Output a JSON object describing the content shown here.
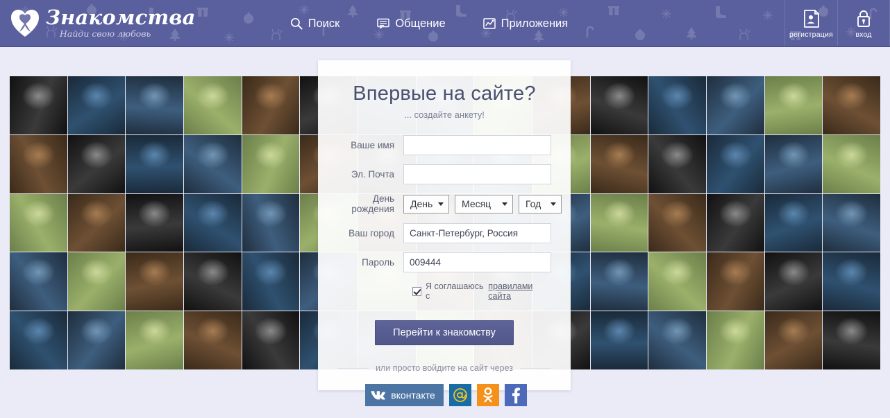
{
  "header": {
    "logo": {
      "icon": "heart-with-ribbon-icon",
      "title": "Знакомства",
      "subtitle": "Найди свою любовь"
    },
    "nav": [
      {
        "label": "Поиск",
        "icon": "search-icon"
      },
      {
        "label": "Общение",
        "icon": "chat-bubble-icon"
      },
      {
        "label": "Приложения",
        "icon": "apps-chart-icon"
      }
    ],
    "auth": [
      {
        "label": "регистрация",
        "icon": "id-card-icon"
      },
      {
        "label": "вход",
        "icon": "lock-icon"
      }
    ],
    "bg_color": "#5a5f9e",
    "pattern": "new-year-ornaments"
  },
  "page": {
    "background_color": "#eaebf7"
  },
  "mosaic": {
    "name": "profile-photo-mosaic",
    "columns": 15,
    "rows": 5
  },
  "form": {
    "title": "Впервые на сайте?",
    "subtitle": "... создайте анкету!",
    "fields": [
      {
        "label": "Ваше имя",
        "value": "",
        "placeholder": ""
      },
      {
        "label": "Эл. Почта",
        "value": "",
        "placeholder": ""
      },
      {
        "label": "Ваш город",
        "value": "Санкт-Петербург, Россия",
        "placeholder": ""
      },
      {
        "label": "Пароль",
        "value": "009444",
        "placeholder": ""
      }
    ],
    "birthday": {
      "label": "День рождения",
      "day": "День",
      "month": "Месяц",
      "year": "Год"
    },
    "agreement": {
      "checked": true,
      "text": "Я соглашаюсь с ",
      "link": "правилами сайта"
    },
    "submit_label": "Перейти к знакомству",
    "or_text": "или просто войдите на сайт через",
    "social": [
      {
        "name": "vkontakte",
        "label": "вконтакте",
        "color": "#4c75a3"
      },
      {
        "name": "mailru",
        "label": "",
        "color": "#1a6ca5"
      },
      {
        "name": "odnoklassniki",
        "label": "",
        "color": "#f3911b"
      },
      {
        "name": "facebook",
        "label": "",
        "color": "#4c69ba"
      }
    ],
    "accent_color": "#5e6399"
  }
}
